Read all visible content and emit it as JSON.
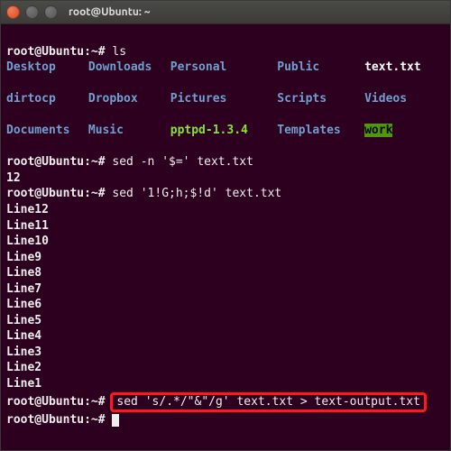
{
  "window": {
    "title": "root@Ubuntu: ~"
  },
  "prompt": {
    "full": "root@Ubuntu:~#",
    "host": "root@Ubuntu",
    "sep": ":",
    "path": "~",
    "hash": "#"
  },
  "commands": {
    "ls": "ls",
    "sed_count": "sed -n '$=' text.txt",
    "sed_reverse": "sed '1!G;h;$!d' text.txt",
    "sed_quote": "sed 's/.*/\"&\"/g' text.txt > text-output.txt"
  },
  "ls_output": {
    "rows": [
      {
        "c1": "Desktop",
        "c2": "Downloads",
        "c3": "Personal",
        "c4": "Public",
        "c5": "text.txt",
        "c5_type": "file"
      },
      {
        "c1": "dirtocp",
        "c2": "Dropbox",
        "c3": "Pictures",
        "c4": "Scripts",
        "c5": "Videos",
        "c5_type": "dir"
      },
      {
        "c1": "Documents",
        "c2": "Music",
        "c3": "pptpd-1.3.4",
        "c4": "Templates",
        "c5": "work",
        "c5_type": "sel"
      }
    ]
  },
  "sed_count_output": "12",
  "reverse_output": [
    "Line12",
    "Line11",
    "Line10",
    "Line9",
    "Line8",
    "Line7",
    "Line6",
    "Line5",
    "Line4",
    "Line3",
    "Line2",
    "Line1"
  ],
  "colors": {
    "bg": "#2c001e",
    "fg": "#eeeeec",
    "dir": "#729fcf",
    "exec": "#8ae234",
    "highlight_bg": "#4e9a06",
    "annotation_border": "#ff1a1a"
  }
}
